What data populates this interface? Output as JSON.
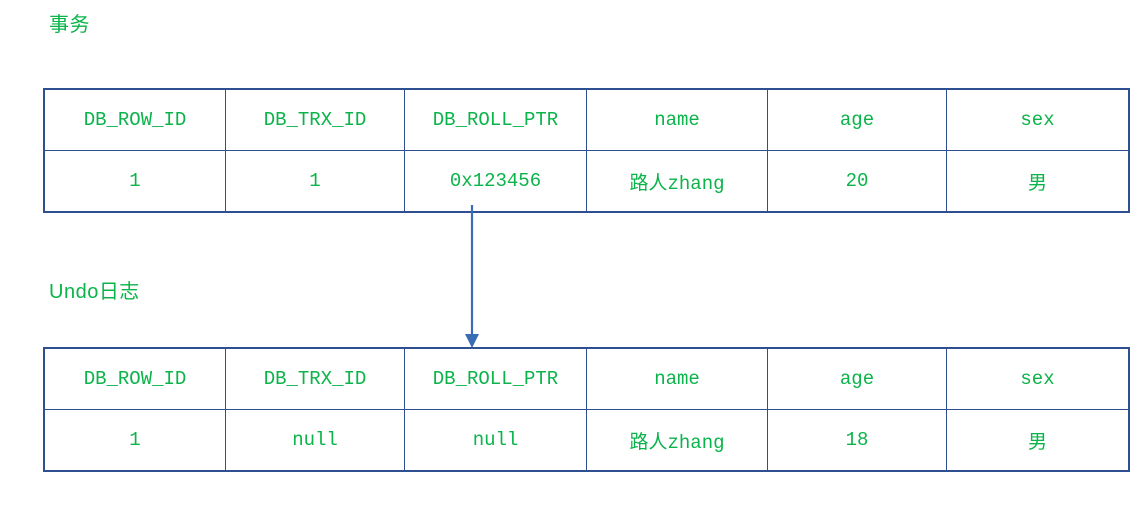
{
  "colors": {
    "text_green": "#0bb44a",
    "border_blue": "#2e5090",
    "arrow_blue": "#3a6bb5",
    "background": "#ffffff"
  },
  "labels": {
    "transaction": "事务",
    "undolog": "Undo日志"
  },
  "columns": [
    "DB_ROW_ID",
    "DB_TRX_ID",
    "DB_ROLL_PTR",
    "name",
    "age",
    "sex"
  ],
  "transaction_table": {
    "headers": [
      "DB_ROW_ID",
      "DB_TRX_ID",
      "DB_ROLL_PTR",
      "name",
      "age",
      "sex"
    ],
    "rows": [
      [
        "1",
        "1",
        "0x123456",
        "路人zhang",
        "20",
        "男"
      ]
    ]
  },
  "undolog_table": {
    "headers": [
      "DB_ROW_ID",
      "DB_TRX_ID",
      "DB_ROLL_PTR",
      "name",
      "age",
      "sex"
    ],
    "rows": [
      [
        "1",
        "null",
        "null",
        "路人zhang",
        "18",
        "男"
      ]
    ]
  },
  "connector": {
    "name": "down-arrow",
    "direction": "down",
    "from": "transaction_table",
    "to": "undolog_table"
  }
}
